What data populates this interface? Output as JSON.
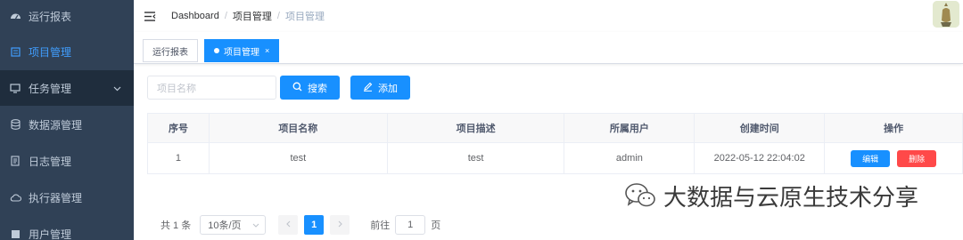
{
  "sidebar": {
    "items": [
      {
        "label": "运行报表",
        "icon": "dashboard-icon"
      },
      {
        "label": "项目管理",
        "icon": "list-icon",
        "active": true
      },
      {
        "label": "任务管理",
        "icon": "monitor-icon"
      },
      {
        "label": "数据源管理",
        "icon": "database-icon"
      },
      {
        "label": "日志管理",
        "icon": "document-icon"
      },
      {
        "label": "执行器管理",
        "icon": "cloud-icon"
      },
      {
        "label": "用户管理",
        "icon": "user-icon"
      }
    ]
  },
  "header": {
    "breadcrumb": [
      "Dashboard",
      "项目管理",
      "项目管理"
    ]
  },
  "tags": [
    {
      "label": "运行报表"
    },
    {
      "label": "项目管理",
      "close": "×",
      "active": true
    }
  ],
  "toolbar": {
    "search_placeholder": "项目名称",
    "search_label": "搜索",
    "add_label": "添加"
  },
  "table": {
    "headers": [
      "序号",
      "项目名称",
      "项目描述",
      "所属用户",
      "创建时间",
      "操作"
    ],
    "rows": [
      {
        "index": "1",
        "name": "test",
        "desc": "test",
        "user": "admin",
        "created": "2022-05-12 22:04:02",
        "edit": "编辑",
        "delete": "删除"
      }
    ]
  },
  "watermark": {
    "text": "大数据与云原生技术分享"
  },
  "pagination": {
    "total": "共 1 条",
    "page_size": "10条/页",
    "current": "1",
    "goto_prefix": "前往",
    "goto_value": "1",
    "goto_suffix": "页"
  },
  "colors": {
    "primary": "#1890ff",
    "danger": "#ff4949",
    "sidebar": "#304156"
  }
}
